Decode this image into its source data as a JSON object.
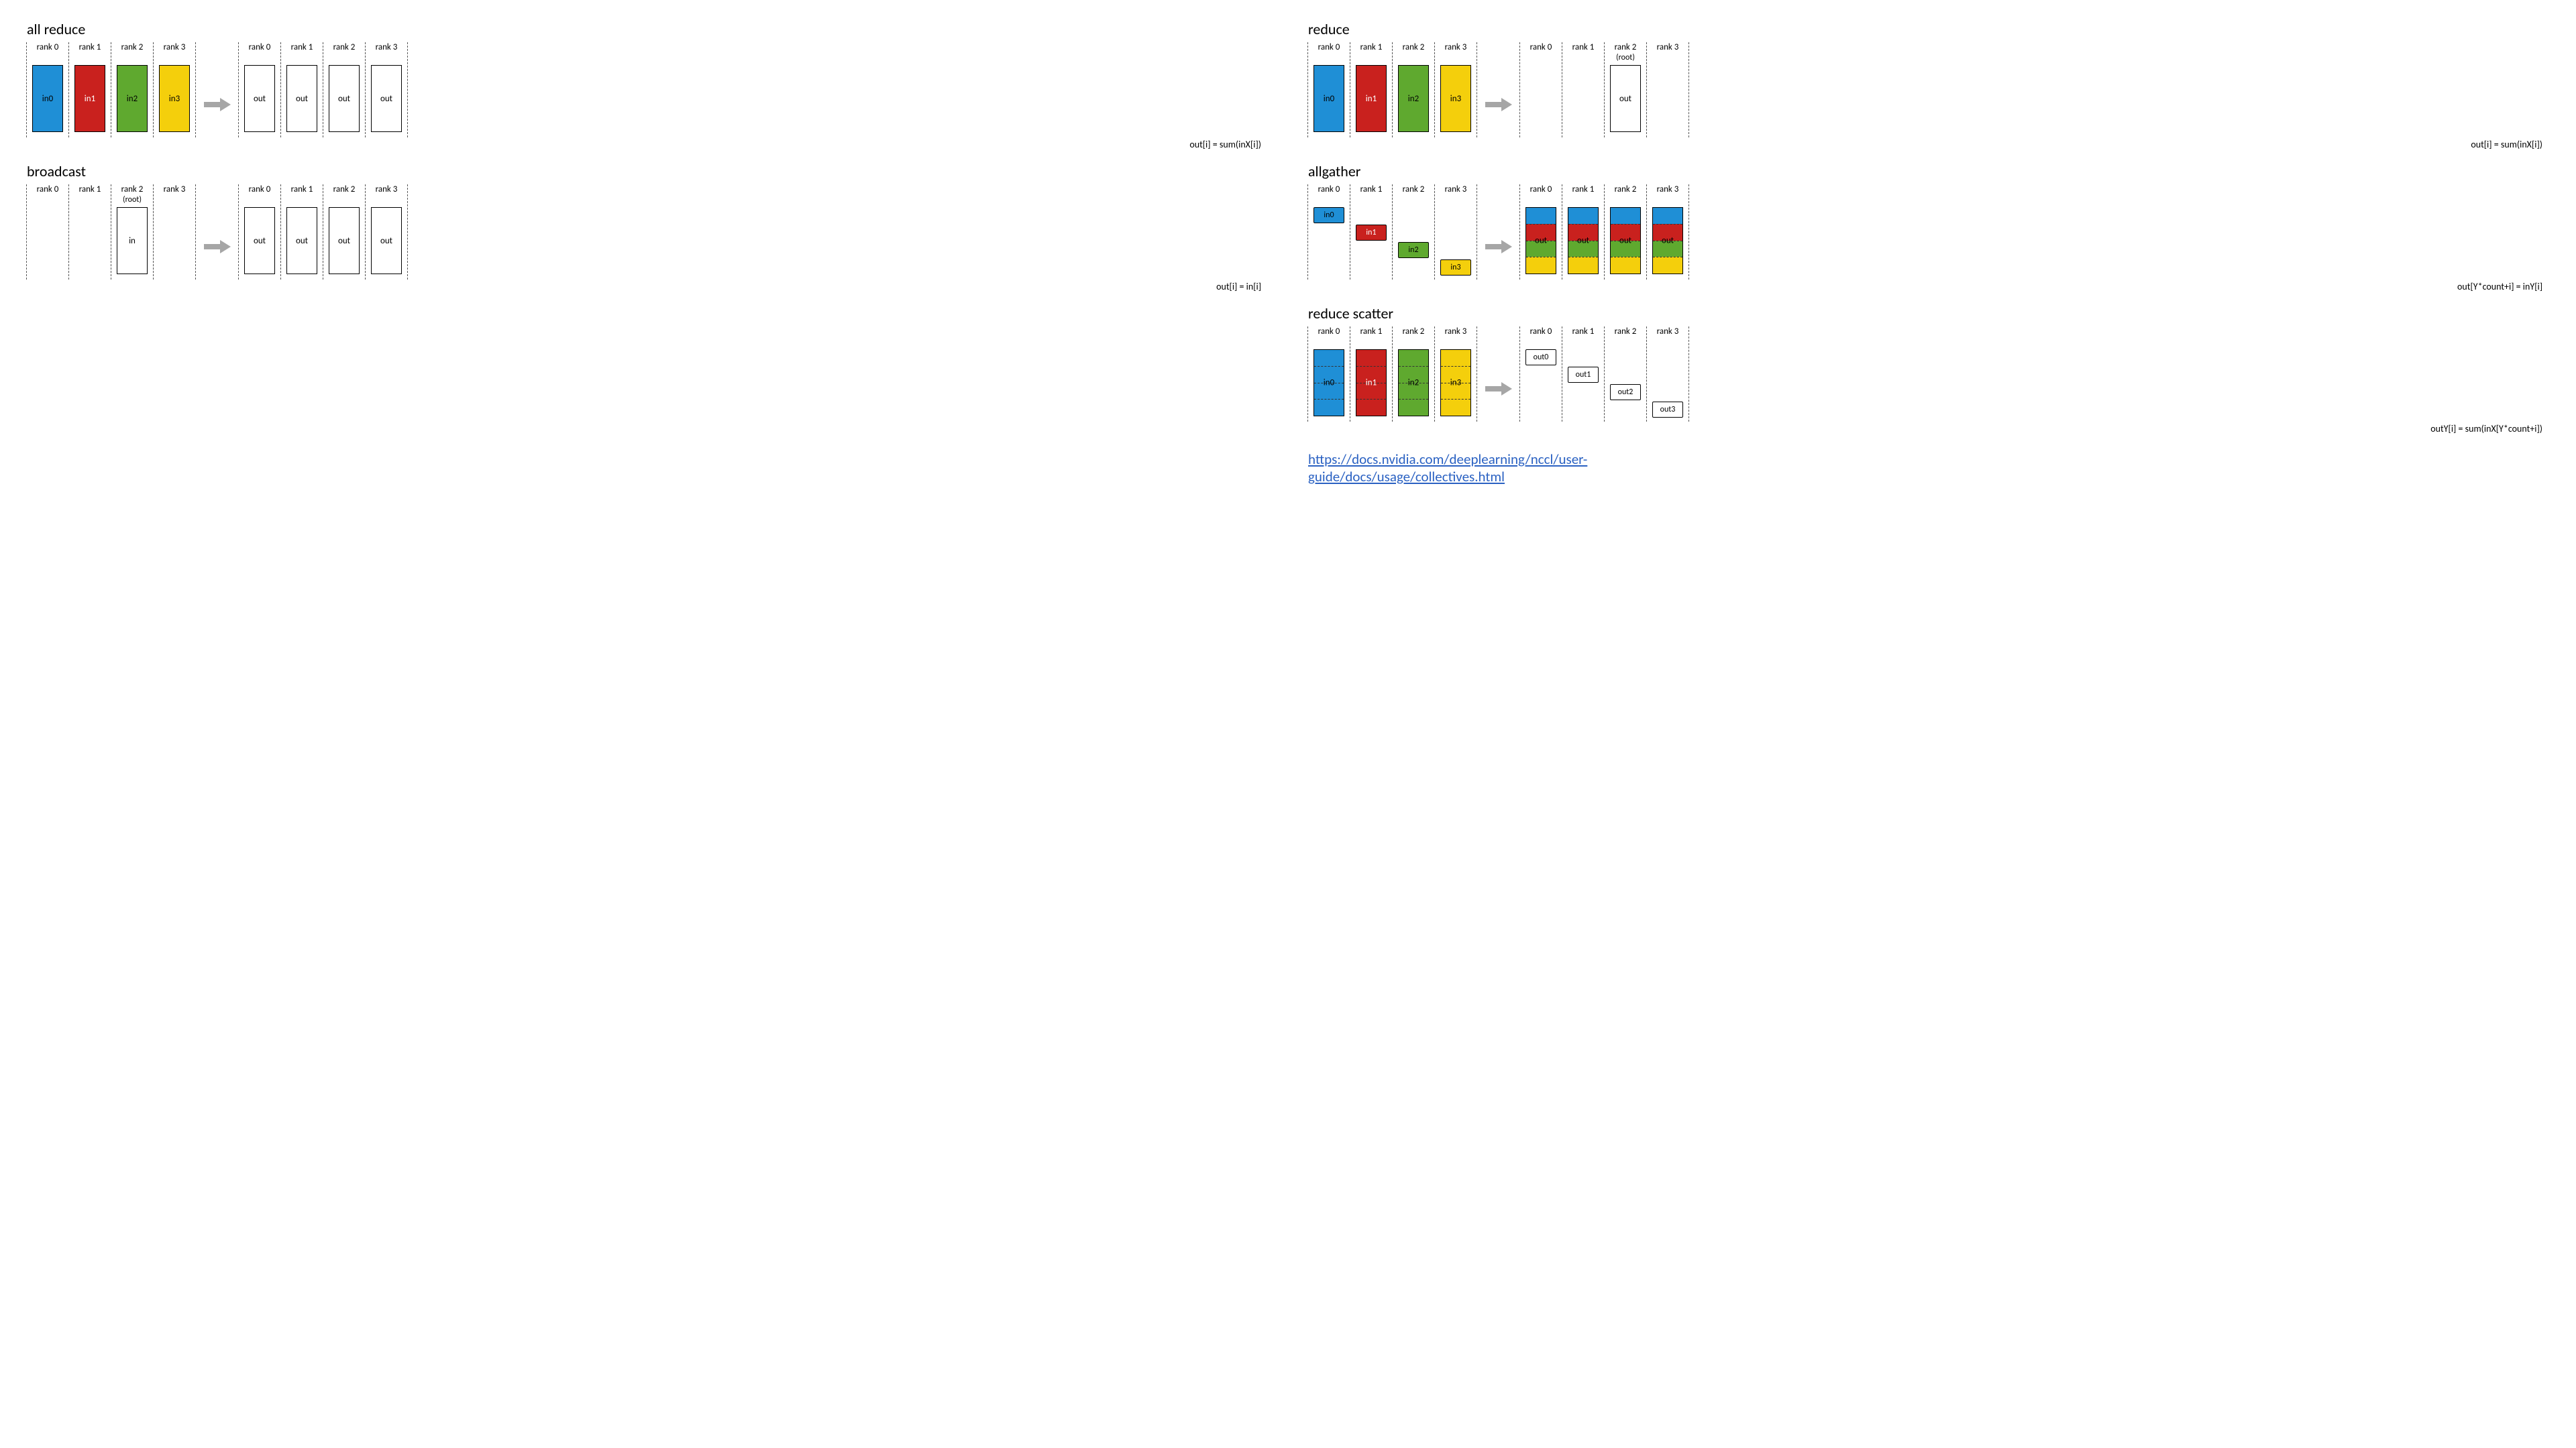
{
  "colors": {
    "blue": "#1f8fd6",
    "red": "#c9211e",
    "green": "#5fa92f",
    "yellow": "#f4cf0c"
  },
  "labels": {
    "rank0": "rank 0",
    "rank1": "rank 1",
    "rank2": "rank 2",
    "rank3": "rank 3",
    "root": "(root)",
    "in": "in",
    "in0": "in0",
    "in1": "in1",
    "in2": "in2",
    "in3": "in3",
    "out": "out",
    "out0": "out0",
    "out1": "out1",
    "out2": "out2",
    "out3": "out3"
  },
  "sections": {
    "allreduce": {
      "title": "all reduce",
      "formula": "out[i] = sum(inX[i])"
    },
    "broadcast": {
      "title": "broadcast",
      "formula": "out[i] = in[i]"
    },
    "reduce": {
      "title": "reduce",
      "formula": "out[i] = sum(inX[i])"
    },
    "allgather": {
      "title": "allgather",
      "formula": "out[Y*count+i] = inY[i]"
    },
    "reducescatter": {
      "title": "reduce scatter",
      "formula": "outY[i] = sum(inX[Y*count+i])"
    }
  },
  "link": {
    "text_line1": "https://docs.nvidia.com/deeplearning/nccl/user-",
    "text_line2": "guide/docs/usage/collectives.html",
    "href": "https://docs.nvidia.com/deeplearning/nccl/user-guide/docs/usage/collectives.html"
  }
}
